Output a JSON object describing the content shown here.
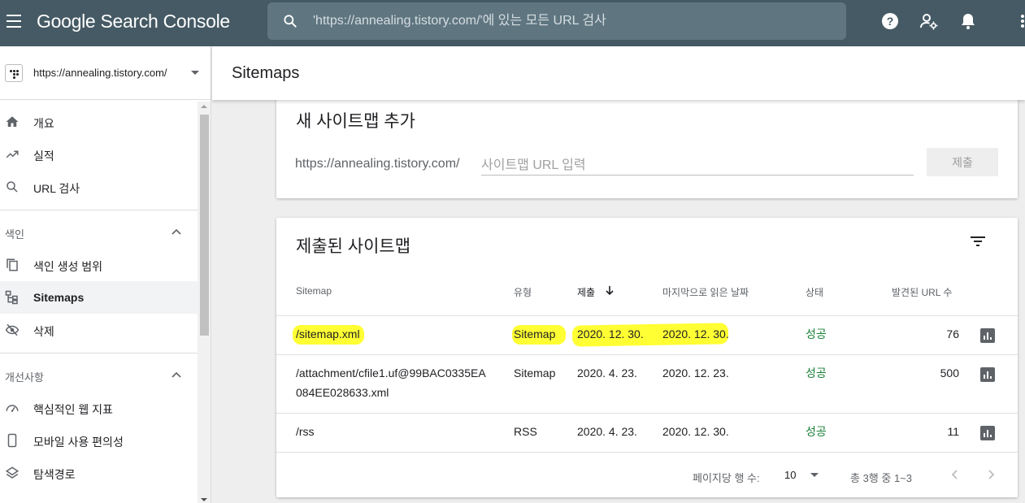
{
  "app": {
    "title": "Google Search Console",
    "search_placeholder": "'https://annealing.tistory.com/'에 있는 모든 URL 검사"
  },
  "property": {
    "url": "https://annealing.tistory.com/"
  },
  "sidebar": {
    "top_items": [
      {
        "label": "개요",
        "icon": "home-icon"
      },
      {
        "label": "실적",
        "icon": "trending-up-icon"
      },
      {
        "label": "URL 검사",
        "icon": "search-icon"
      }
    ],
    "sections": [
      {
        "title": "색인",
        "items": [
          {
            "label": "색인 생성 범위",
            "icon": "copy-icon"
          },
          {
            "label": "Sitemaps",
            "icon": "sitemap-icon",
            "active": true
          },
          {
            "label": "삭제",
            "icon": "eye-off-icon"
          }
        ]
      },
      {
        "title": "개선사항",
        "items": [
          {
            "label": "핵심적인 웹 지표",
            "icon": "speed-icon"
          },
          {
            "label": "모바일 사용 편의성",
            "icon": "phone-icon"
          },
          {
            "label": "탐색경로",
            "icon": "layers-icon"
          }
        ]
      }
    ]
  },
  "page": {
    "title": "Sitemaps"
  },
  "add_sitemap": {
    "title": "새 사이트맵 추가",
    "prefix": "https://annealing.tistory.com/",
    "placeholder": "사이트맵 URL 입력",
    "submit_label": "제출"
  },
  "submitted": {
    "title": "제출된 사이트맵",
    "columns": [
      "Sitemap",
      "유형",
      "제출",
      "마지막으로 읽은 날짜",
      "상태",
      "발견된 URL 수"
    ],
    "sorted_column": "제출",
    "rows": [
      {
        "sitemap": "/sitemap.xml",
        "type": "Sitemap",
        "submitted": "2020. 12. 30.",
        "last_read": "2020. 12. 30.",
        "status": "성공",
        "urls": "76"
      },
      {
        "sitemap_line1": "/attachment/cfile1.uf@99BAC0335EA",
        "sitemap_line2": "084EE028633.xml",
        "type": "Sitemap",
        "submitted": "2020. 4. 23.",
        "last_read": "2020. 12. 23.",
        "status": "성공",
        "urls": "500"
      },
      {
        "sitemap": "/rss",
        "type": "RSS",
        "submitted": "2020. 4. 23.",
        "last_read": "2020. 12. 30.",
        "status": "성공",
        "urls": "11"
      }
    ],
    "footer": {
      "rows_per_page_label": "페이지당 행 수:",
      "rows_per_page": "10",
      "range": "총 3행 중 1~3"
    }
  },
  "colors": {
    "topbar": "#455a64",
    "success": "#188038",
    "highlight": "#ffff33"
  }
}
